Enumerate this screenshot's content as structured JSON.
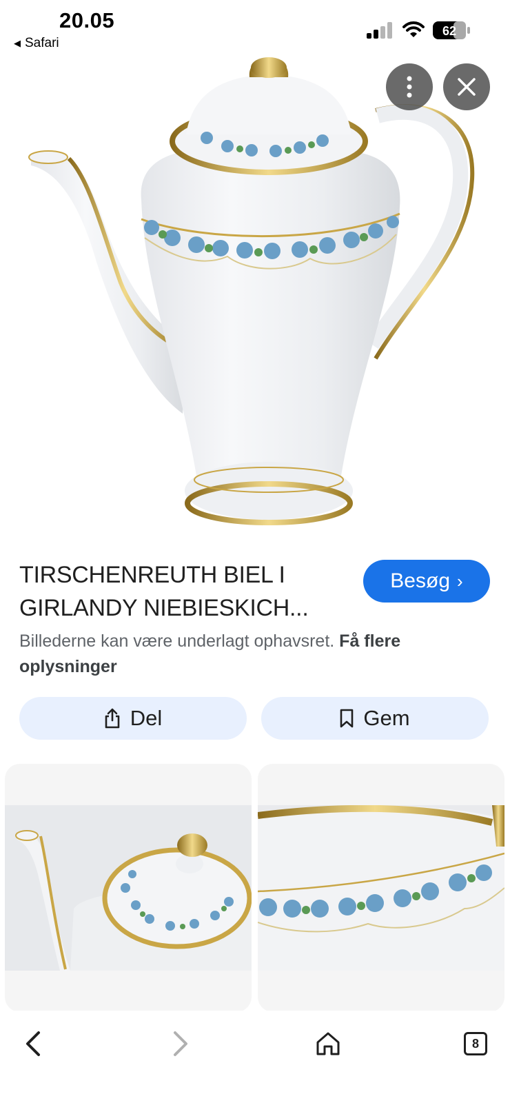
{
  "status_bar": {
    "time": "20.05",
    "back_app": "Safari",
    "battery": "62"
  },
  "hero": {
    "image_icon": "teapot-image"
  },
  "overlay": {
    "more_icon": "more-vertical-icon",
    "close_icon": "close-icon"
  },
  "result": {
    "title": "TIRSCHENREUTH BIEL I GIRLANDY NIEBIESKICH...",
    "visit_label": "Besøg",
    "disclaimer": "Billederne kan være underlagt ophavsret.",
    "more_info": "Få flere oplysninger"
  },
  "actions": {
    "share_label": "Del",
    "save_label": "Gem"
  },
  "toolbar": {
    "tab_count": "8"
  },
  "colors": {
    "accent": "#1a73e8",
    "chip_bg": "#e8f0fe",
    "gold": "#c9a646",
    "floral_blue": "#6a9fc7",
    "floral_green": "#5a9a55"
  }
}
